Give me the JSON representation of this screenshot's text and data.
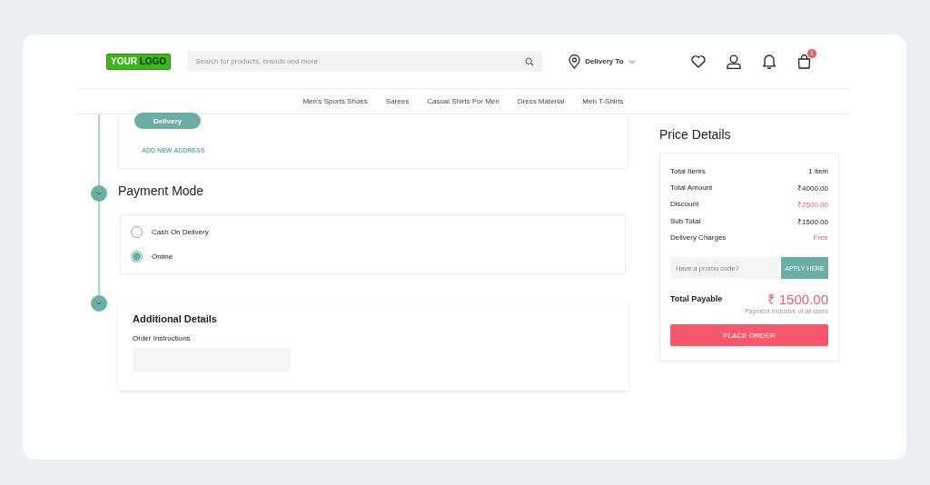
{
  "header": {
    "logo": {
      "part1": "YOUR",
      "part2": "LOGO"
    },
    "search": {
      "placeholder": "Search for products, brands and more"
    },
    "delivery": "Delivery To",
    "cart_count": "1"
  },
  "nav": [
    "Men's Sports Shoes",
    "Sarees",
    "Casual Shirts For Men",
    "Dress Material",
    "Men T-Shirts"
  ],
  "address": {
    "tag": "Delivery",
    "add_link": "ADD NEW ADDRESS"
  },
  "payment": {
    "title": "Payment Mode",
    "options": [
      {
        "label": "Cash On Delivery",
        "selected": false
      },
      {
        "label": "Online",
        "selected": true
      }
    ]
  },
  "additional": {
    "title": "Additional Details",
    "label": "Order Instructions"
  },
  "price": {
    "title": "Price Details",
    "rows": [
      {
        "label": "Total Items",
        "value": "1 item",
        "highlight": false
      },
      {
        "label": "Total Amount",
        "value": "₹4000.00",
        "highlight": false
      },
      {
        "label": "Discount",
        "value": "₹2500.00",
        "highlight": true
      },
      {
        "label": "Sub Total",
        "value": "₹1500.00",
        "highlight": false
      },
      {
        "label": "Delivery Charges",
        "value": "Free",
        "highlight": true
      }
    ],
    "promo_placeholder": "Have a promo code?",
    "apply": "APPLY HERE",
    "total_label": "Total Payable",
    "total": "₹ 1500.00",
    "note": "Payment inclusive of all taxes",
    "order": "PLACE ORDER"
  }
}
